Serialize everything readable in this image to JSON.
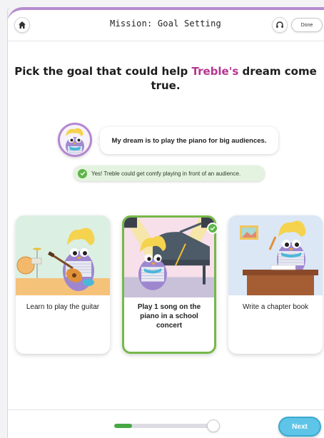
{
  "header": {
    "title": "Mission: Goal Setting",
    "done_label": "Done",
    "home_icon": "home-icon",
    "audio_icon": "headphones-icon"
  },
  "question": {
    "prefix": "Pick the goal that could help ",
    "highlight": "Treble's",
    "suffix": " dream come true."
  },
  "dream": {
    "text": "My dream is to play the piano for big audiences."
  },
  "feedback": {
    "text": "Yes! Treble could get comfy playing in front of an audience."
  },
  "cards": [
    {
      "label": "Learn to play the guitar",
      "selected": false
    },
    {
      "label": "Play 1 song on the piano in a school concert",
      "selected": true
    },
    {
      "label": "Write a chapter book",
      "selected": false
    }
  ],
  "footer": {
    "progress": 0.17,
    "next_label": "Next"
  },
  "colors": {
    "accent_purple": "#b58cd0",
    "highlight_pink": "#b5358f",
    "success_green": "#5cb648",
    "next_blue": "#5ec5e8"
  }
}
